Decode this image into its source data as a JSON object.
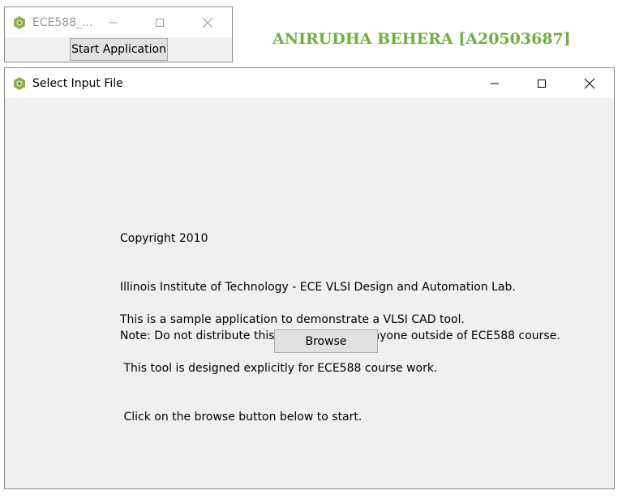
{
  "small_window": {
    "title": "ECE588_...",
    "start_button_label": "Start Application"
  },
  "author_credit": "ANIRUDHA BEHERA [A20503687]",
  "main_window": {
    "title": "Select Input File",
    "copyright_lines": [
      "Copyright 2010",
      "Illinois Institute of Technology - ECE VLSI Design and Automation Lab.",
      "Note: Do not distribute this source code to anyone outside of ECE588 course."
    ],
    "description_lines": [
      "This is a sample application to demonstrate a VLSI CAD tool.",
      " This tool is designed explicitly for ECE588 course work.",
      " Click on the browse button below to start."
    ],
    "browse_button_label": "Browse"
  },
  "colors": {
    "credit_text": "#70ad47",
    "app_icon": "#8ab04a"
  },
  "icons": {
    "app": "app-hexagon-icon",
    "minimize": "minimize-icon",
    "maximize": "maximize-icon",
    "close": "close-icon"
  }
}
